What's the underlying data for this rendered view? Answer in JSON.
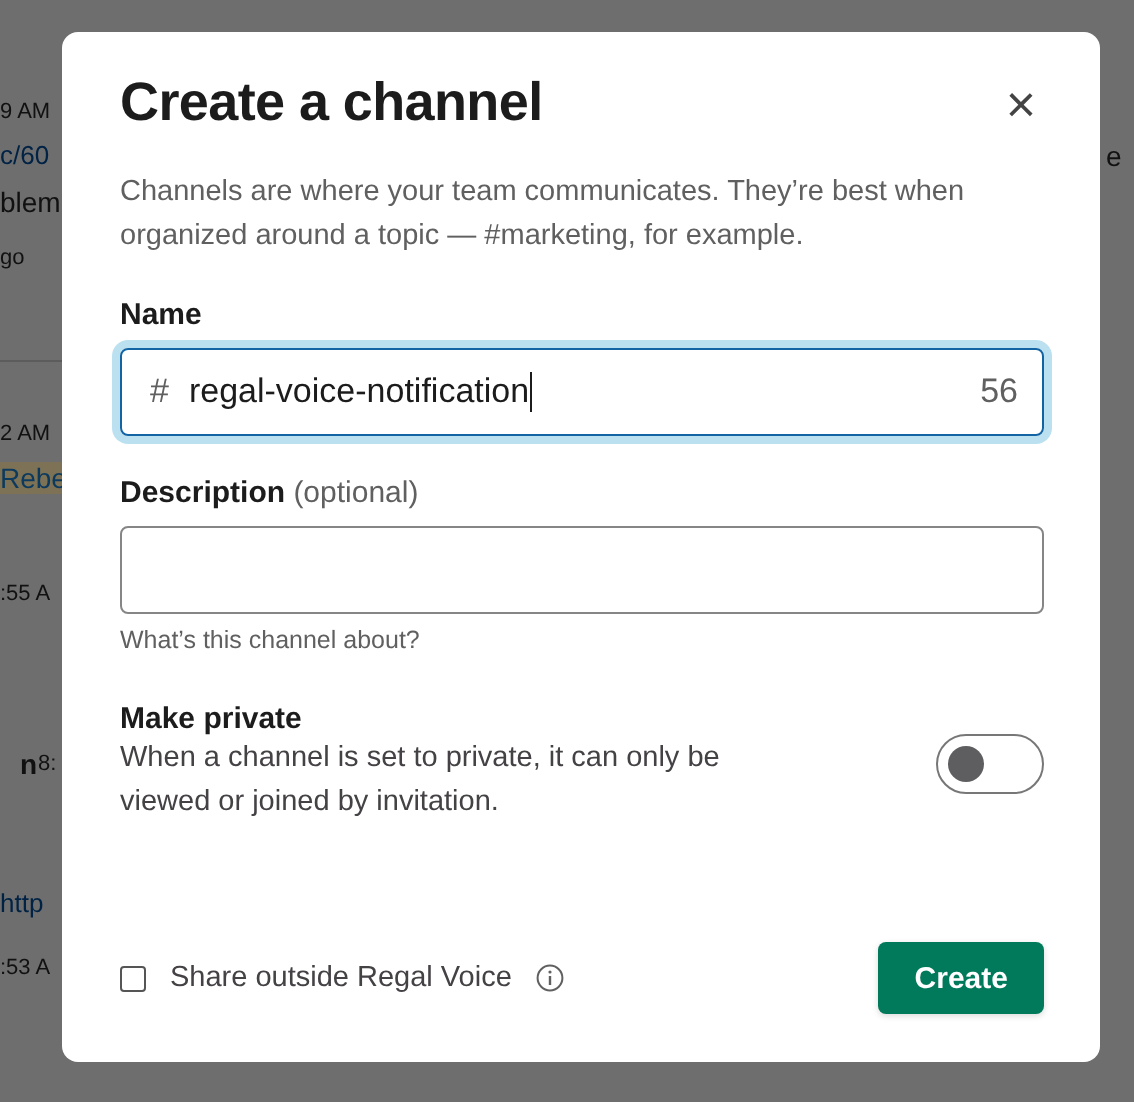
{
  "background": {
    "left_fragments": [
      {
        "text": "9 AM",
        "kind": "time"
      },
      {
        "text": "c/60",
        "kind": "link"
      },
      {
        "text": "blem",
        "kind": "text"
      },
      {
        "text": "go",
        "kind": "time"
      },
      {
        "text": "2 AM",
        "kind": "time"
      },
      {
        "text": "Rebe",
        "kind": "mention"
      },
      {
        "text": ":55 A",
        "kind": "time"
      },
      {
        "text": "n",
        "kind": "name"
      },
      {
        "text": "8:",
        "kind": "time"
      },
      {
        "text": "http",
        "kind": "link"
      },
      {
        "text": ":53 A",
        "kind": "time"
      }
    ],
    "right_fragments": [
      {
        "text": "e",
        "kind": "text"
      }
    ]
  },
  "dialog": {
    "title": "Create a channel",
    "close": "×",
    "intro": "Channels are where your team communicates. They’re best when organized around a topic — #marketing, for example.",
    "name_field": {
      "label": "Name",
      "prefix": "#",
      "value": "regal-voice-notification",
      "counter": "56",
      "focused": true
    },
    "description_field": {
      "label": "Description",
      "optional": "(optional)",
      "hint": "What’s this channel about?"
    },
    "private": {
      "label": "Make private",
      "description": "When a channel is set to private, it can only be viewed or joined by invitation.",
      "on": false
    },
    "share": {
      "label": "Share outside Regal Voice",
      "checked": false
    },
    "create_button": "Create"
  }
}
